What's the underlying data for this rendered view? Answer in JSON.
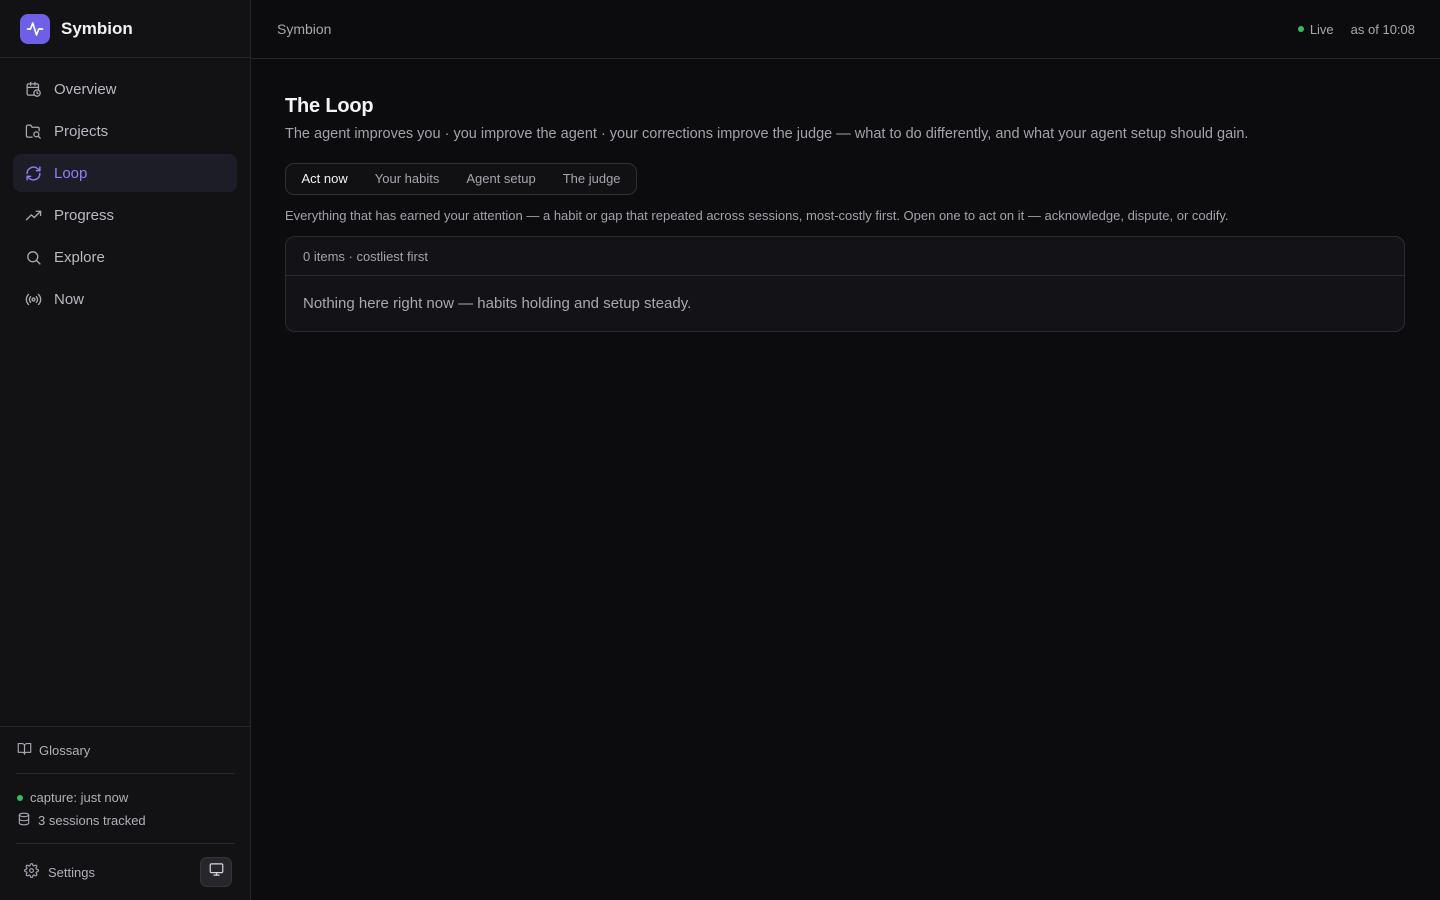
{
  "app": {
    "name": "Symbion"
  },
  "sidebar": {
    "items": [
      {
        "label": "Overview",
        "icon": "calendar-clock-icon",
        "active": false
      },
      {
        "label": "Projects",
        "icon": "folder-search-icon",
        "active": false
      },
      {
        "label": "Loop",
        "icon": "refresh-icon",
        "active": true
      },
      {
        "label": "Progress",
        "icon": "trending-up-icon",
        "active": false
      },
      {
        "label": "Explore",
        "icon": "search-icon",
        "active": false
      },
      {
        "label": "Now",
        "icon": "radio-broadcast-icon",
        "active": false
      }
    ],
    "glossary": "Glossary",
    "capture": "capture: just now",
    "sessions": "3 sessions tracked",
    "settings": "Settings"
  },
  "topbar": {
    "breadcrumb": "Symbion",
    "live": "Live",
    "as_of": "as of 10:08"
  },
  "main": {
    "title": "The Loop",
    "subtitle": "The agent improves you · you improve the agent · your corrections improve the judge — what to do differently, and what your agent setup should gain.",
    "tabs": [
      {
        "label": "Act now",
        "active": true
      },
      {
        "label": "Your habits",
        "active": false
      },
      {
        "label": "Agent setup",
        "active": false
      },
      {
        "label": "The judge",
        "active": false
      }
    ],
    "description": "Everything that has earned your attention — a habit or gap that repeated across sessions, most-costly first. Open one to act on it — acknowledge, dispute, or codify.",
    "panel": {
      "header": "0 items · costliest first",
      "empty": "Nothing here right now — habits holding and setup steady."
    }
  },
  "colors": {
    "accent": "#6d5fe6",
    "active_text": "#8b80f3",
    "live_dot": "#2fbf5b"
  }
}
